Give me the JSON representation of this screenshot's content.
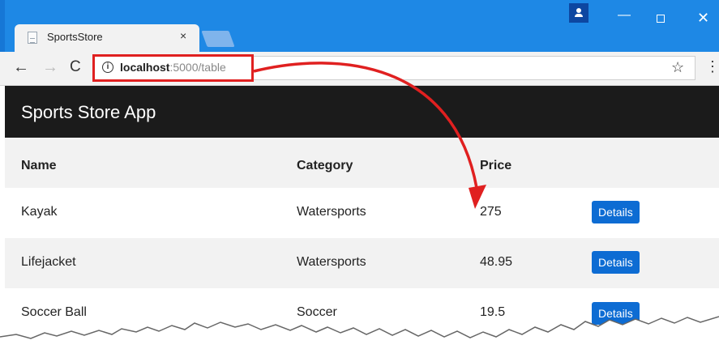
{
  "browser": {
    "tab_title": "SportsStore",
    "tab_close": "×",
    "url_host": "localhost",
    "url_rest": ":5000/table",
    "info_glyph": "i",
    "back_glyph": "←",
    "forward_glyph": "→",
    "reload_glyph": "C",
    "star_glyph": "☆",
    "menu_glyph": "⋮",
    "min_glyph": "—",
    "close_glyph": "✕"
  },
  "app": {
    "brand": "Sports Store App"
  },
  "table": {
    "headers": [
      "Name",
      "Category",
      "Price"
    ],
    "rows": [
      {
        "name": "Kayak",
        "category": "Watersports",
        "price": "275",
        "action": "Details"
      },
      {
        "name": "Lifejacket",
        "category": "Watersports",
        "price": "48.95",
        "action": "Details"
      },
      {
        "name": "Soccer Ball",
        "category": "Soccer",
        "price": "19.5",
        "action": "Details"
      }
    ]
  },
  "colors": {
    "titlebar": "#1e88e5",
    "navbar": "#1b1b1b",
    "button": "#0d6cd3",
    "annotation": "#e02020"
  },
  "icons": [
    "page-icon",
    "close-icon",
    "new-tab-icon",
    "profile-icon",
    "minimize-icon",
    "maximize-icon",
    "close-window-icon",
    "back-icon",
    "forward-icon",
    "reload-icon",
    "info-icon",
    "star-icon",
    "menu-icon",
    "arrow-icon"
  ]
}
